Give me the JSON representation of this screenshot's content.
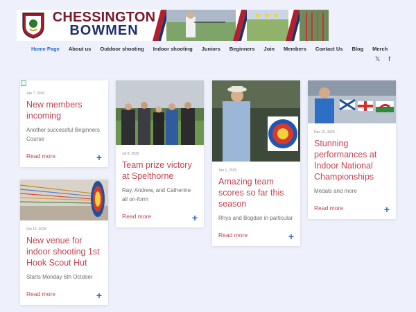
{
  "brand": {
    "line1": "CHESSINGTON",
    "line2": "BOWMEN"
  },
  "nav": [
    {
      "label": "Home Page",
      "active": true
    },
    {
      "label": "About us"
    },
    {
      "label": "Outdoor shooting"
    },
    {
      "label": "Indoor shooting"
    },
    {
      "label": "Juniors"
    },
    {
      "label": "Beginners"
    },
    {
      "label": "Join"
    },
    {
      "label": "Members"
    },
    {
      "label": "Contact Us"
    },
    {
      "label": "Blog"
    },
    {
      "label": "Merch"
    }
  ],
  "social": {
    "x_glyph": "𝕏",
    "facebook_glyph": "f"
  },
  "posts": [
    {
      "date": "Jan 7, 2026",
      "title": "New members incoming",
      "excerpt": "Another successful Beginners Course",
      "more": "Read more",
      "plus": "+"
    },
    {
      "date": "Oct 16, 2025",
      "title": "New venue for indoor shooting 1st Hook Scout Hut",
      "excerpt": "Starts Monday 6th October",
      "more": "Read more",
      "plus": "+"
    },
    {
      "date": "Jul 8, 2025",
      "title": "Team prize victory at Spelthorne",
      "excerpt": "Ray, Andrew, and Catherine all on-form",
      "more": "Read more",
      "plus": "+"
    },
    {
      "date": "Jun 1, 2025",
      "title": "Amazing team scores so far this season",
      "excerpt": "Rhys and Bogdan in particular",
      "more": "Read more",
      "plus": "+"
    },
    {
      "date": "Dec 15, 2025",
      "title": "Stunning performances at Indoor National Championships",
      "excerpt": "Medals and more",
      "more": "Read more",
      "plus": "+"
    }
  ]
}
